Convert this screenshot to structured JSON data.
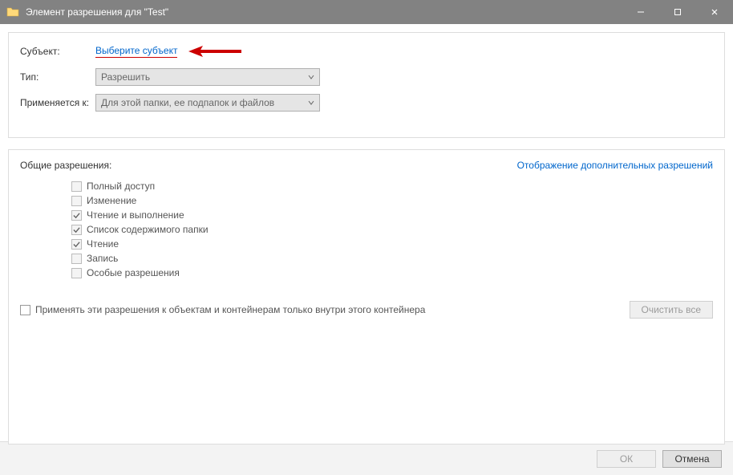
{
  "window": {
    "title": "Элемент разрешения для \"Test\""
  },
  "top": {
    "subject_label": "Субъект:",
    "subject_link": "Выберите субъект",
    "type_label": "Тип:",
    "type_value": "Разрешить",
    "applies_label": "Применяется к:",
    "applies_value": "Для этой папки, ее подпапок и файлов"
  },
  "permissions": {
    "title": "Общие разрешения:",
    "advanced_link": "Отображение дополнительных разрешений",
    "items": [
      {
        "label": "Полный доступ",
        "checked": false
      },
      {
        "label": "Изменение",
        "checked": false
      },
      {
        "label": "Чтение и выполнение",
        "checked": true
      },
      {
        "label": "Список содержимого папки",
        "checked": true
      },
      {
        "label": "Чтение",
        "checked": true
      },
      {
        "label": "Запись",
        "checked": false
      },
      {
        "label": "Особые разрешения",
        "checked": false
      }
    ],
    "apply_only": "Применять эти разрешения к объектам и контейнерам только внутри этого контейнера",
    "clear_all": "Очистить все"
  },
  "footer": {
    "ok": "ОК",
    "cancel": "Отмена"
  }
}
